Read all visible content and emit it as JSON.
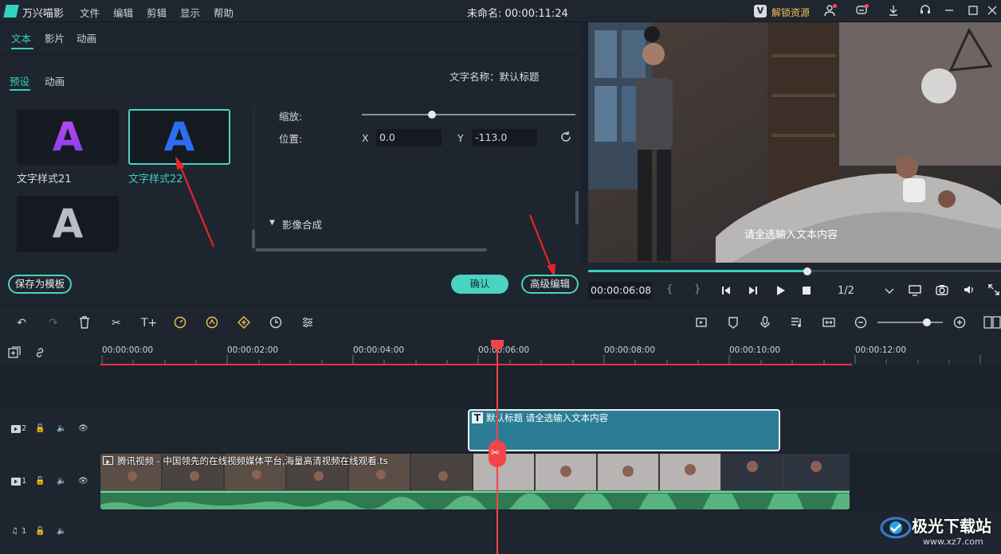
{
  "titlebar": {
    "app_name": "万兴喵影",
    "menu": [
      "文件",
      "编辑",
      "剪辑",
      "显示",
      "帮助"
    ],
    "project_title": "未命名: 00:00:11:24",
    "unlock_label": "解锁资源"
  },
  "left_panel": {
    "tabs": [
      "文本",
      "影片",
      "动画"
    ],
    "active_tab": "文本",
    "subtabs": [
      "预设",
      "动画"
    ],
    "active_subtab": "预设",
    "styles": [
      {
        "label": "文字样式21",
        "glyph": "A",
        "selected": false
      },
      {
        "label": "文字样式22",
        "glyph": "A",
        "selected": true
      },
      {
        "label": "",
        "glyph": "A",
        "selected": false
      }
    ],
    "text_name_label": "文字名称：默认标题",
    "scale_label": "缩放:",
    "scale_value": 0.33,
    "position_label": "位置:",
    "x_label": "X",
    "x_value": "0.0",
    "y_label": "Y",
    "y_value": "-113.0",
    "composite_label": "影像合成",
    "save_template": "保存为模板",
    "confirm": "确认",
    "advanced_edit": "高级编辑"
  },
  "preview": {
    "overlay_text": "请全选输入文本内容",
    "current_time": "00:00:06:08",
    "quality": "1/2",
    "progress": 0.53
  },
  "timeline": {
    "ruler_ticks": [
      "00:00:00:00",
      "00:00:02:00",
      "00:00:04:00",
      "00:00:06:00",
      "00:00:08:00",
      "00:00:10:00",
      "00:00:12:00"
    ],
    "text_clip_label": "默认标题 请全选输入文本内容",
    "video_clip_label": "腾讯视频 - 中国领先的在线视频媒体平台,海量高清视频在线观看.ts",
    "track_labels": [
      "2",
      "1",
      "1"
    ],
    "zoom_level": 0.75
  },
  "watermark": {
    "site_name": "极光下载站",
    "site_url": "www.xz7.com"
  }
}
